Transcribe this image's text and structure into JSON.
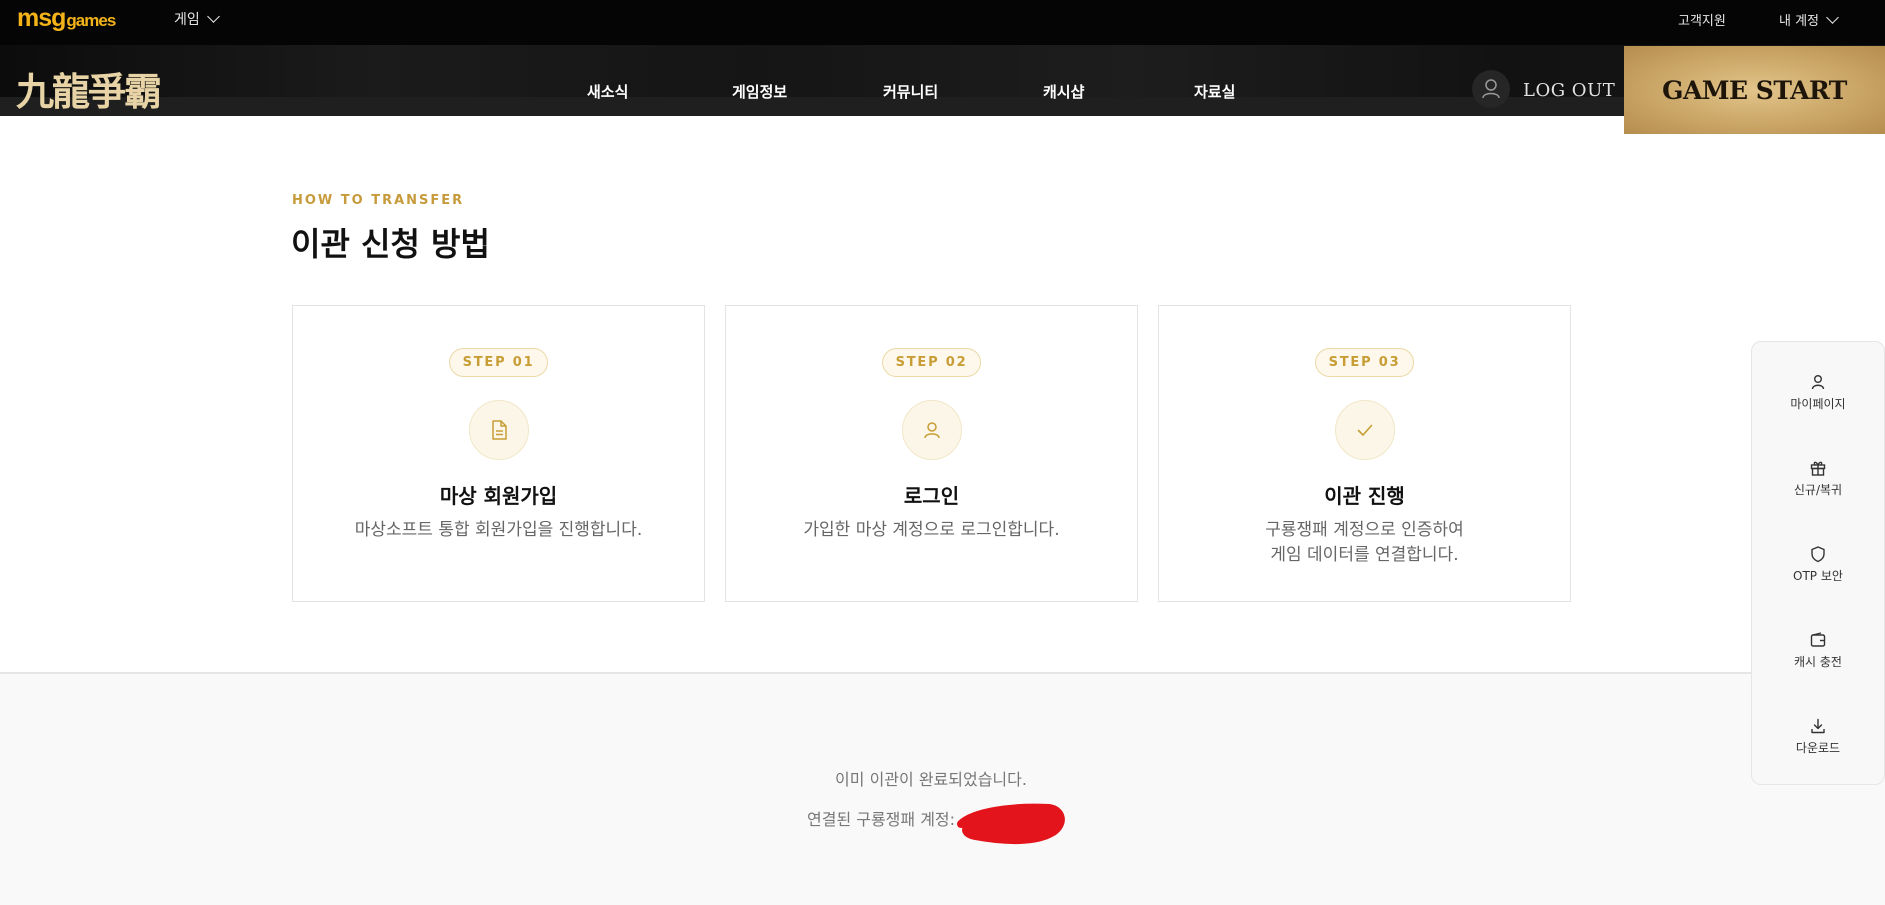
{
  "topbar": {
    "logo_main": "msg",
    "logo_sub": "games",
    "game_menu": "게임",
    "support": "고객지원",
    "my_account": "내 계정"
  },
  "navbar": {
    "brand": "九龍爭霸",
    "items": [
      "새소식",
      "게임정보",
      "커뮤니티",
      "캐시샵",
      "자료실"
    ],
    "logout": "LOG OUT",
    "game_start": "GAME START"
  },
  "section": {
    "eyebrow": "HOW TO TRANSFER",
    "title": "이관 신청 방법"
  },
  "steps": [
    {
      "badge": "STEP 01",
      "icon": "document-icon",
      "title": "마상 회원가입",
      "desc": "마상소프트 통합 회원가입을 진행합니다."
    },
    {
      "badge": "STEP 02",
      "icon": "user-icon",
      "title": "로그인",
      "desc": "가입한 마상 계정으로 로그인합니다."
    },
    {
      "badge": "STEP 03",
      "icon": "check-icon",
      "title": "이관 진행",
      "desc": "구룡쟁패 계정으로 인증하여\n게임 데이터를 연결합니다."
    }
  ],
  "status": {
    "done": "이미 이관이 완료되었습니다.",
    "linked_label": "연결된 구룡쟁패 계정:"
  },
  "quick_menu": [
    {
      "label": "마이페이지",
      "icon": "user-icon"
    },
    {
      "label": "신규/복귀",
      "icon": "gift-icon"
    },
    {
      "label": "OTP 보안",
      "icon": "shield-icon"
    },
    {
      "label": "캐시 충전",
      "icon": "wallet-icon"
    },
    {
      "label": "다운로드",
      "icon": "download-icon"
    }
  ],
  "colors": {
    "accent": "#c89d35",
    "topbar": "#050505",
    "logo": "#f3b319",
    "redaction": "#e3141b"
  }
}
